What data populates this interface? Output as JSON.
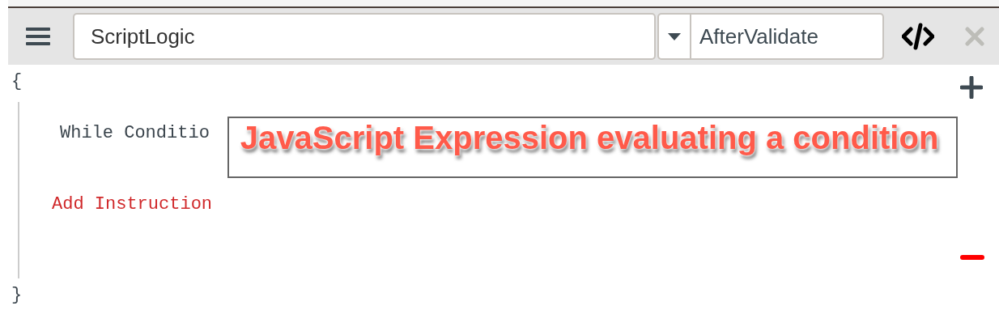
{
  "toolbar": {
    "name_value": "ScriptLogic",
    "event_value": "AfterValidate"
  },
  "editor": {
    "open_brace": "{",
    "condition_label": "While Conditio",
    "condition_annotation": "JavaScript Expression evaluating a condition",
    "add_instruction": "Add Instruction",
    "close_brace": "}"
  }
}
